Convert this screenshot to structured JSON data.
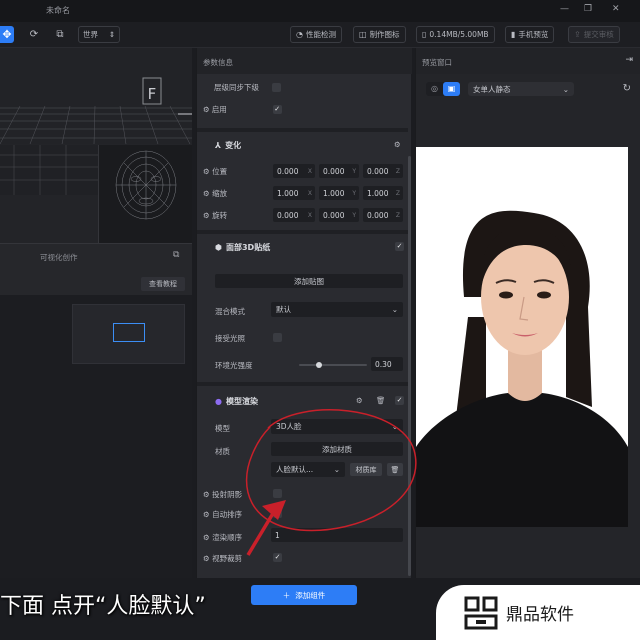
{
  "window": {
    "title": "未命名"
  },
  "toolbar": {
    "space_select": "世界",
    "perf_label": "性能检测",
    "make_icon_label": "制作图标",
    "size_label": "0.14MB/5.00MB",
    "mobile_preview_label": "手机预览",
    "submit_label": "提交审核"
  },
  "left": {
    "panel_title": "可视化创作",
    "tutorial_button": "查看教程",
    "gizmo_letter": "F"
  },
  "params": {
    "header": "参数信息",
    "layer_sync_label": "层级同步下级",
    "enable_label": "启用",
    "transform": {
      "title": "变化",
      "position_label": "位置",
      "scale_label": "缩放",
      "rotation_label": "旋转",
      "position": [
        "0.000",
        "0.000",
        "0.000"
      ],
      "scale": [
        "1.000",
        "1.000",
        "1.000"
      ],
      "rotation": [
        "0.000",
        "0.000",
        "0.000"
      ]
    },
    "face_sticker": {
      "title": "面部3D贴纸",
      "add_texture_button": "添加贴图",
      "blend_mode_label": "混合模式",
      "blend_mode_value": "默认",
      "accept_light_label": "接受光照",
      "ambient_label": "环境光强度",
      "ambient_value": "0.30",
      "ambient_level": 0.3
    },
    "model_render": {
      "title": "模型渲染",
      "model_label": "模型",
      "model_value": "3D人脸",
      "material_label": "材质",
      "add_material_button": "添加材质",
      "material_value": "人脸默认...",
      "material_lib_button": "材质库",
      "cast_shadow_label": "投射阴影",
      "auto_sort_label": "自动排序",
      "render_order_label": "渲染顺序",
      "render_order_value": "1",
      "frustum_cull_label": "视野裁剪"
    },
    "add_component_button": "添加组件"
  },
  "preview": {
    "header": "预览窗口",
    "scene_select": "女单人静态"
  },
  "overlay": {
    "subtitle": "下面 点开“人脸默认”",
    "watermark": "鼎品软件"
  },
  "colors": {
    "accent": "#2d7df6",
    "annotation": "#c9202a"
  },
  "icons": {
    "move": "move-icon",
    "refresh": "refresh-icon",
    "gear": "gear-icon",
    "trash": "trash-icon"
  }
}
